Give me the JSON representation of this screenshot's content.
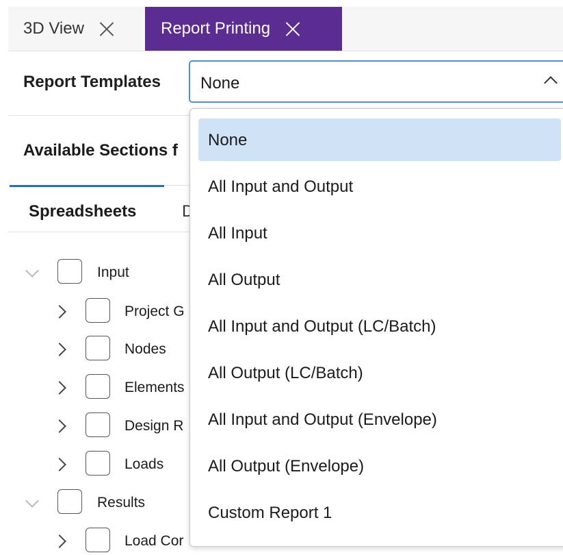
{
  "tabs": [
    {
      "label": "3D View"
    },
    {
      "label": "Report Printing"
    }
  ],
  "colors": {
    "active_tab": "#5b2c92",
    "accent": "#1e6fc9",
    "selected_option": "#cfe2f6"
  },
  "report_templates": {
    "label": "Report Templates",
    "value": "None"
  },
  "available_sections": {
    "label": "Available Sections f"
  },
  "subtabs": [
    {
      "label": "Spreadsheets"
    },
    {
      "label": "D"
    }
  ],
  "tree": [
    {
      "label": "Input",
      "level": 0,
      "expanded": true
    },
    {
      "label": "Project G",
      "level": 1,
      "expanded": false
    },
    {
      "label": "Nodes",
      "level": 1,
      "expanded": false
    },
    {
      "label": "Elements",
      "level": 1,
      "expanded": false
    },
    {
      "label": "Design R",
      "level": 1,
      "expanded": false
    },
    {
      "label": "Loads",
      "level": 1,
      "expanded": false
    },
    {
      "label": "Results",
      "level": 0,
      "expanded": true
    },
    {
      "label": "Load Cor",
      "level": 1,
      "expanded": false
    }
  ],
  "dropdown_options": [
    {
      "label": "None",
      "selected": true
    },
    {
      "label": "All Input and Output",
      "selected": false
    },
    {
      "label": "All Input",
      "selected": false
    },
    {
      "label": "All Output",
      "selected": false
    },
    {
      "label": "All Input and Output (LC/Batch)",
      "selected": false
    },
    {
      "label": "All Output (LC/Batch)",
      "selected": false
    },
    {
      "label": "All Input and Output (Envelope)",
      "selected": false
    },
    {
      "label": "All Output (Envelope)",
      "selected": false
    },
    {
      "label": "Custom Report 1",
      "selected": false
    }
  ]
}
